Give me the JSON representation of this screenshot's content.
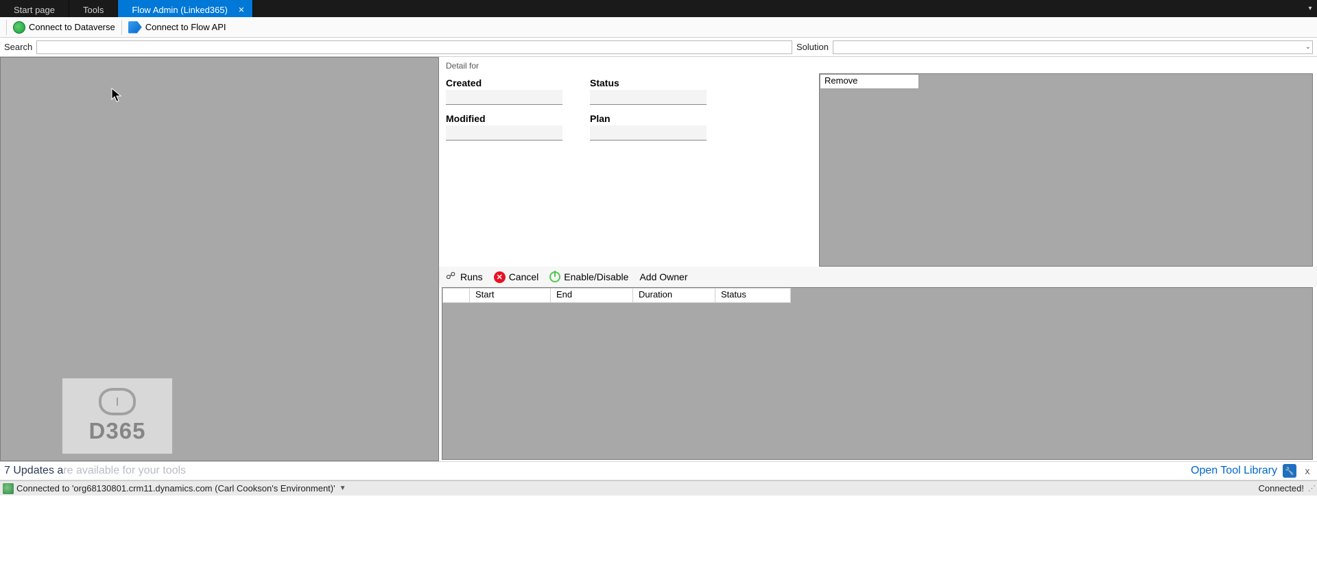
{
  "tabs": {
    "start": "Start page",
    "tools": "Tools",
    "active": "Flow Admin (Linked365)"
  },
  "toolbar": {
    "connect_dataverse": "Connect to Dataverse",
    "connect_flowapi": "Connect to Flow API"
  },
  "searchrow": {
    "search_label": "Search",
    "solution_label": "Solution"
  },
  "detail": {
    "title": "Detail for",
    "created_label": "Created",
    "modified_label": "Modified",
    "status_label": "Status",
    "plan_label": "Plan",
    "remove_label": "Remove"
  },
  "actions": {
    "runs": "Runs",
    "cancel": "Cancel",
    "enable_disable": "Enable/Disable",
    "add_owner": "Add Owner"
  },
  "runs_table": {
    "columns": {
      "start": "Start",
      "end": "End",
      "duration": "Duration",
      "status": "Status"
    }
  },
  "watermark": {
    "text": "D365"
  },
  "updatebar": {
    "prefix": "7 Updates a",
    "faded": "re available for your tools",
    "open_tool_library": "Open Tool Library",
    "close": "x"
  },
  "statusbar": {
    "connection": "Connected to 'org68130801.crm11.dynamics.com (Carl Cookson's Environment)'",
    "connected": "Connected!"
  }
}
